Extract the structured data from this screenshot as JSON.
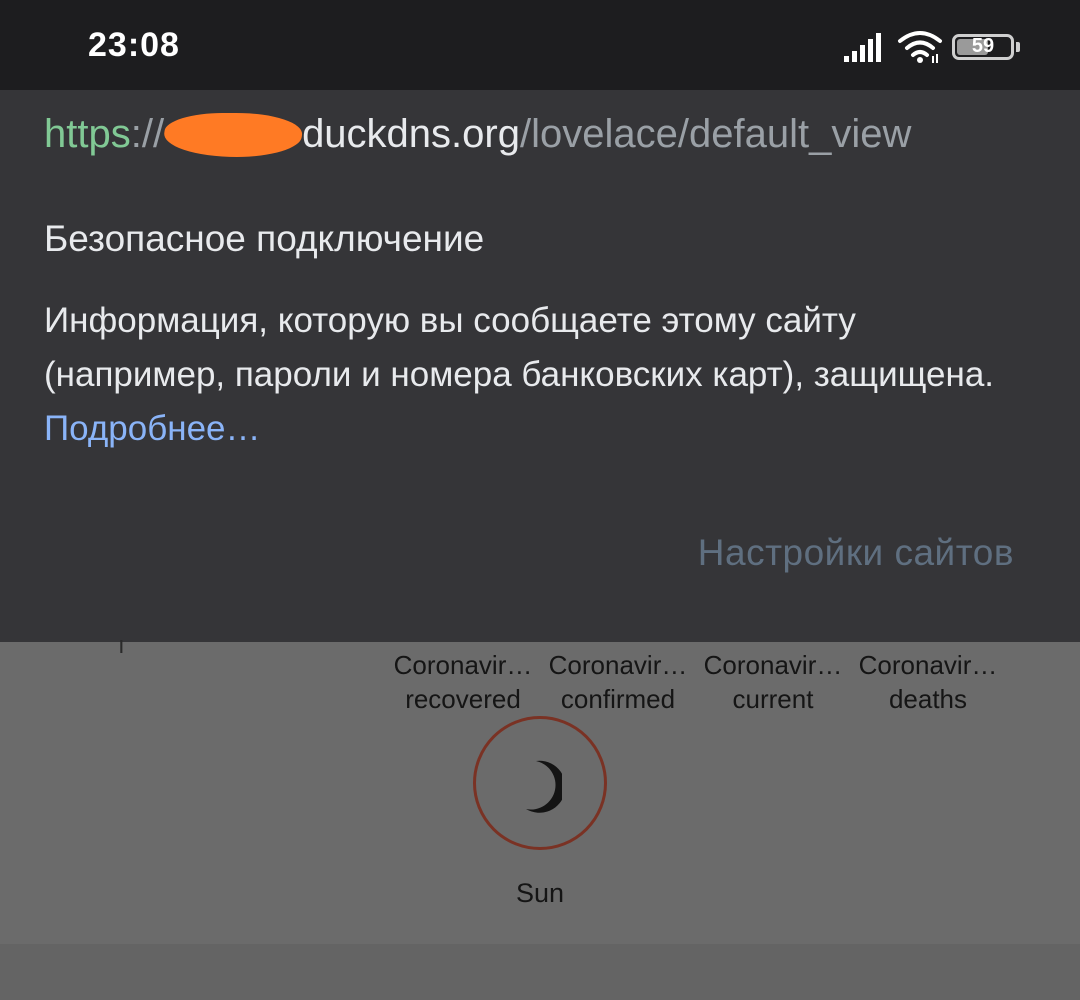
{
  "status_bar": {
    "time": "23:08",
    "battery_level": "59",
    "battery_fraction": 0.59,
    "icons": [
      "signal-icon",
      "wifi-icon",
      "battery-icon"
    ]
  },
  "popup": {
    "url": {
      "scheme": "https",
      "separator": "://",
      "host_visible": "duckdns.org",
      "path": "/lovelace/default_view"
    },
    "title": "Безопасное подключение",
    "body": "Информация, которую вы сообщаете этому сайту (например, пароли и номера банковских карт), защищена.",
    "learn_more": "Подробнее…",
    "site_settings": "Настройки сайтов"
  },
  "dashboard": {
    "sensors": [
      {
        "name": "Coronavir…",
        "state": "recovered"
      },
      {
        "name": "Coronavir…",
        "state": "confirmed"
      },
      {
        "name": "Coronavir…",
        "state": "current"
      },
      {
        "name": "Coronavir…",
        "state": "deaths"
      }
    ],
    "sun_label": "Sun",
    "sun_icon": "moon-icon"
  },
  "colors": {
    "status_bar_bg": "#1d1d1f",
    "popup_bg": "#353538",
    "scheme_green": "#81c995",
    "link_blue": "#8ab4f8",
    "redaction_orange": "#ff7a24",
    "sun_ring": "#7a3224"
  }
}
